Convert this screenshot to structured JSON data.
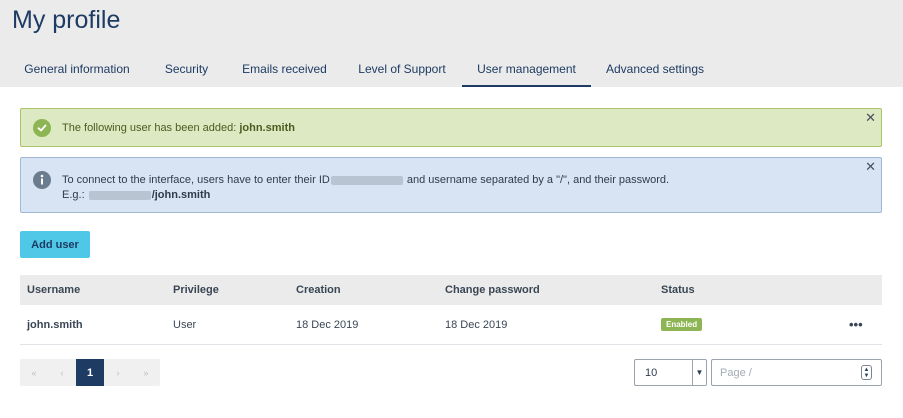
{
  "page": {
    "title": "My profile"
  },
  "tabs": [
    {
      "label": "General information",
      "active": false
    },
    {
      "label": "Security",
      "active": false
    },
    {
      "label": "Emails received",
      "active": false
    },
    {
      "label": "Level of Support",
      "active": false
    },
    {
      "label": "User management",
      "active": true
    },
    {
      "label": "Advanced settings",
      "active": false
    }
  ],
  "alerts": {
    "success": {
      "icon": "check-circle-icon",
      "text": "The following user has been added: ",
      "username": "john.smith",
      "close": "✕"
    },
    "info": {
      "icon": "info-circle-icon",
      "line1_a": "To connect to the interface, users have to enter their ID",
      "line1_b": " and username separated by a \"/\", and their password.",
      "line2_prefix": "E.g.: ",
      "line2_user": "/john.smith",
      "close": "✕"
    }
  },
  "actions": {
    "add_user": "Add user"
  },
  "table": {
    "headers": {
      "username": "Username",
      "privilege": "Privilege",
      "creation": "Creation",
      "change_password": "Change password",
      "status": "Status"
    },
    "rows": [
      {
        "username": "john.smith",
        "privilege": "User",
        "creation": "18 Dec 2019",
        "change_password": "18 Dec 2019",
        "status": "Enabled",
        "more": "•••"
      }
    ]
  },
  "pagination": {
    "first": "«",
    "prev": "‹",
    "current": "1",
    "next": "›",
    "last": "»",
    "page_size": "10",
    "page_placeholder": "Page /"
  },
  "colors": {
    "primary": "#1d3b63",
    "accent": "#4ec8e6",
    "success": "#8db554",
    "info_bg": "#d8e4f3"
  }
}
